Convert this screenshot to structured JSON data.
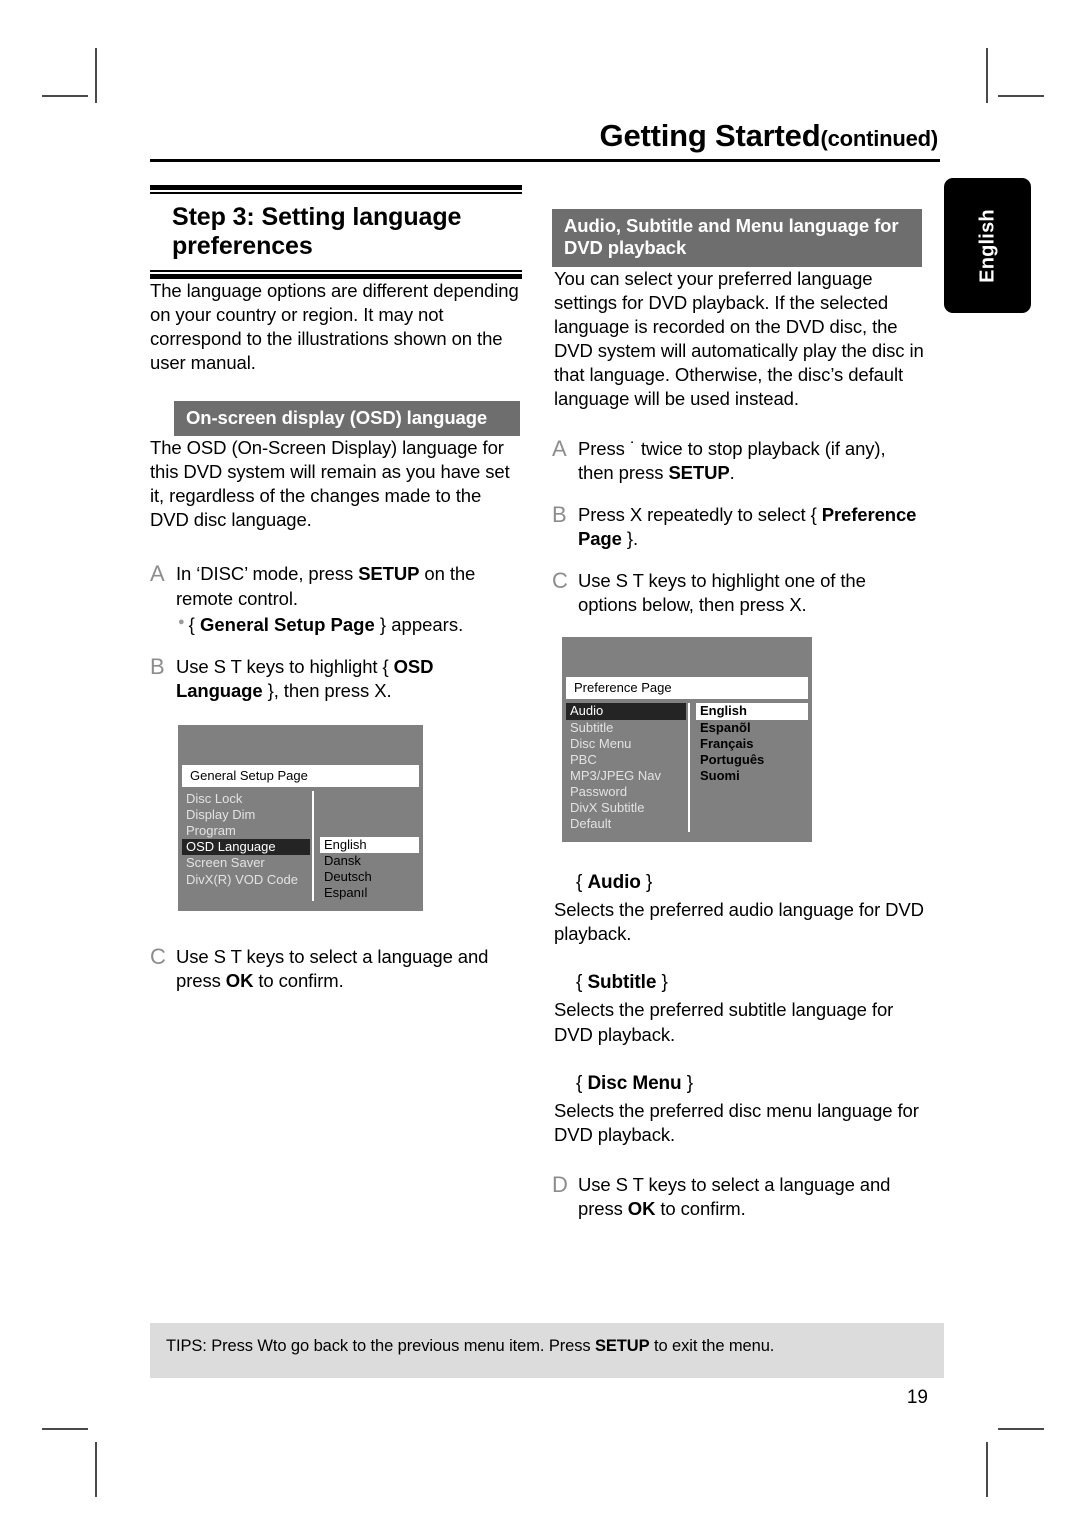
{
  "runhead": {
    "title": "Getting Started",
    "continued": "(continued)"
  },
  "side_tab": {
    "label": "English"
  },
  "left": {
    "step_title": "Step 3:  Setting language preferences",
    "intro": "The language options are different depending on your country or region.  It may not correspond to the illustrations shown on the user manual.",
    "osd_bar": "On-screen display (OSD) language",
    "osd_intro": "The OSD (On-Screen Display) language for this DVD system will remain as you have set it, regardless of the changes made to the DVD disc language.",
    "steps": [
      {
        "letter": "A",
        "text_1": "In ‘DISC’ mode, press ",
        "bold_1": "SETUP",
        "text_2": " on the remote control.",
        "note_brace_open": "{ ",
        "note_bold": "General Setup Page",
        "note_brace_close": " } appears."
      },
      {
        "letter": "B",
        "text_1": "Use  S T  keys to highlight { ",
        "bold_1": "OSD Language",
        "text_2": " }, then press  X."
      },
      {
        "letter": "C",
        "text_1": "Use  S T keys to select a language and press ",
        "bold_1": "OK",
        "text_2": " to confirm."
      }
    ],
    "osd_screen": {
      "title": "General Setup Page",
      "menu_items": [
        "Disc Lock",
        "Display Dim",
        "Program",
        "OSD Language",
        "Screen Saver",
        "DivX(R) VOD Code"
      ],
      "selected_index": 3,
      "options": [
        "English",
        "Dansk",
        "Deutsch",
        "Espanıl"
      ],
      "highlighted_index": 0
    }
  },
  "right": {
    "bar": "Audio, Subtitle and Menu language for DVD playback",
    "intro": "You can select your preferred language settings for DVD playback.  If the selected language is recorded on the DVD disc, the DVD system will automatically play the disc in that language.  Otherwise, the disc’s default language will be used instead.",
    "steps": [
      {
        "letter": "A",
        "text_1": "Press  ˙   twice to stop playback (if any), then press ",
        "bold_1": "SETUP",
        "text_2": "."
      },
      {
        "letter": "B",
        "text_1": "Press  X repeatedly to select { ",
        "bold_1": "Preference Page",
        "text_2": " }."
      },
      {
        "letter": "C",
        "text_1": "Use  S T keys to highlight one of the options below, then press  X.",
        "bold_1": "",
        "text_2": ""
      },
      {
        "letter": "D",
        "text_1": "Use  S T keys to select a language and press ",
        "bold_1": "OK",
        "text_2": " to confirm."
      }
    ],
    "osd_screen": {
      "title": "Preference Page",
      "menu_items": [
        "Audio",
        "Subtitle",
        "Disc Menu",
        "PBC",
        "MP3/JPEG Nav",
        "Password",
        "DivX Subtitle",
        "Default"
      ],
      "selected_index": 0,
      "options": [
        "English",
        "Espanõl",
        "Français",
        "Português",
        "Suomi"
      ],
      "highlighted_index": 0
    },
    "definitions": [
      {
        "open": "{ ",
        "term": "Audio",
        "close": " }",
        "desc": "Selects the preferred audio language for DVD playback."
      },
      {
        "open": "{ ",
        "term": "Subtitle",
        "close": " }",
        "desc": "Selects the preferred subtitle language for DVD playback."
      },
      {
        "open": "{ ",
        "term": "Disc Menu",
        "close": " }",
        "desc": "Selects the preferred disc menu language for DVD playback."
      }
    ]
  },
  "tips": {
    "label": "TIPS:",
    "text_1": " Press  Wto go back to the previous menu item.  Press ",
    "bold_1": "SETUP",
    "text_2": " to exit the menu."
  },
  "page_number": "19",
  "colors": {
    "bar_grey": "#6e6e6e",
    "osd_grey": "#808080",
    "osd_selected": "#242424",
    "tips_grey": "#dcdcdc",
    "letter_grey": "#8d8d8d"
  }
}
